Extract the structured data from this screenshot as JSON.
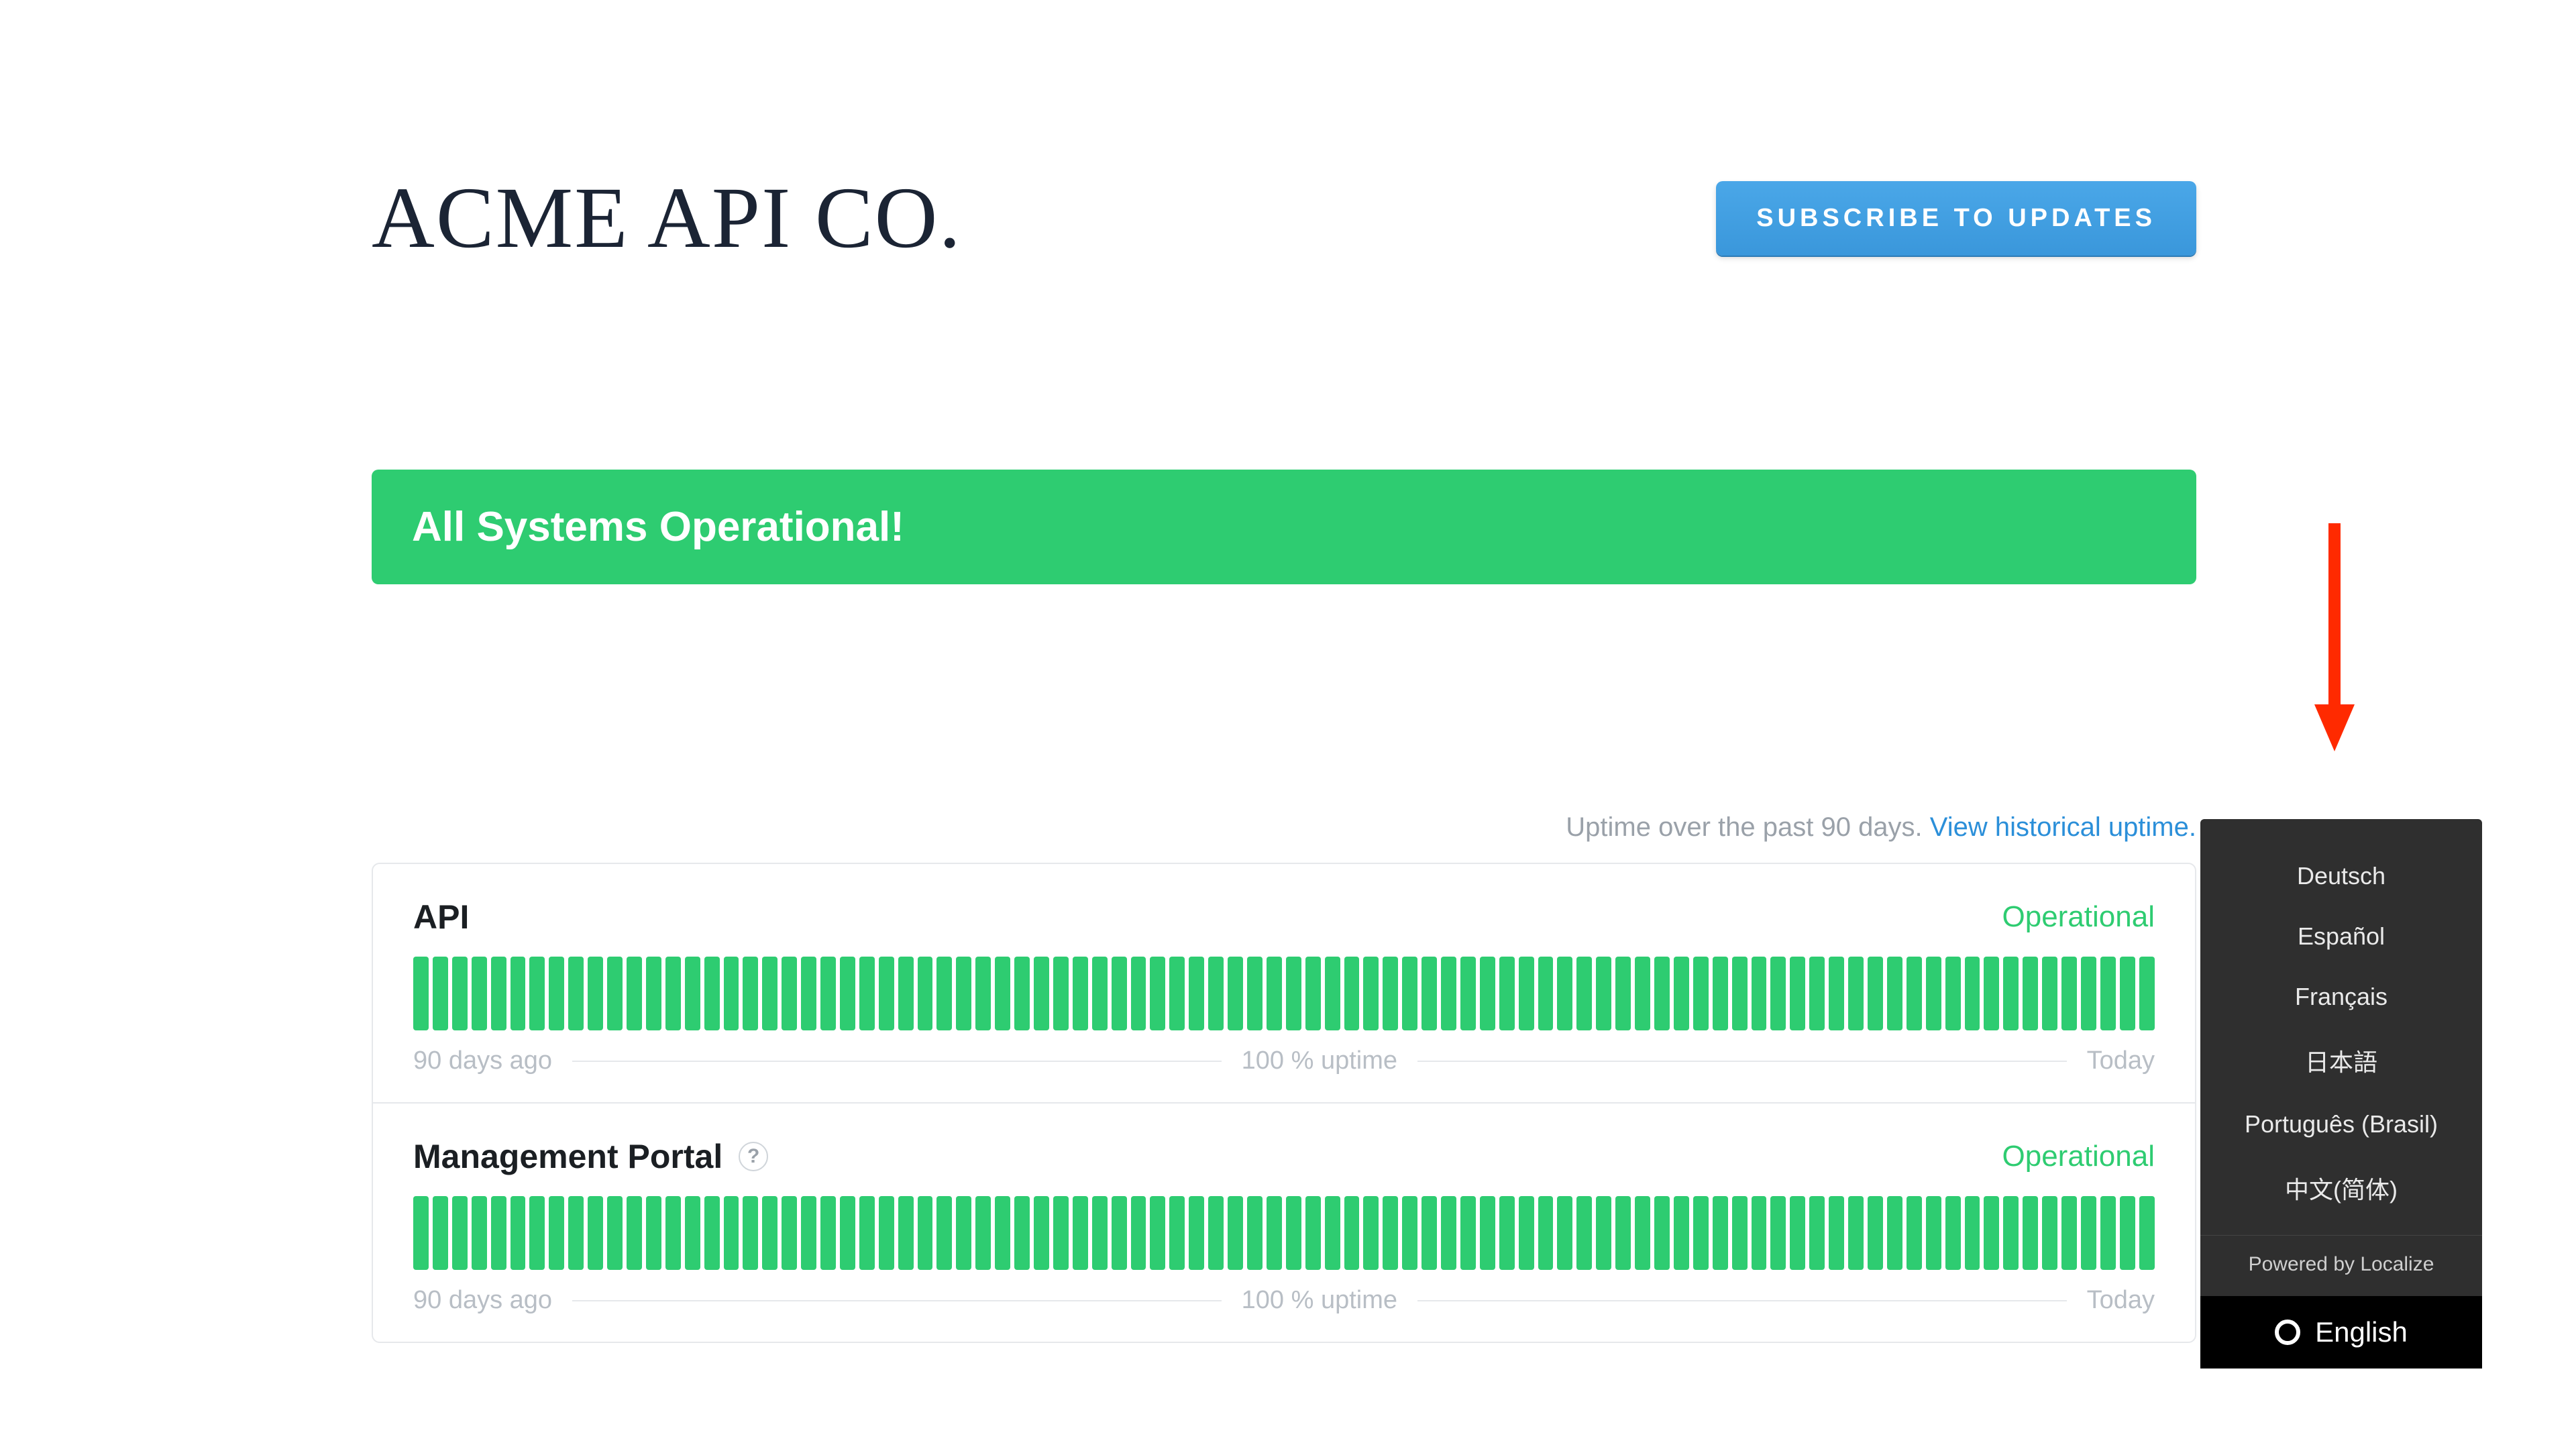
{
  "header": {
    "brand": "ACME API CO.",
    "subscribe_label": "SUBSCRIBE TO UPDATES"
  },
  "status_banner": "All Systems Operational!",
  "uptime_caption": {
    "text": "Uptime over the past 90 days. ",
    "link": "View historical uptime."
  },
  "components": [
    {
      "name": "API",
      "status": "Operational",
      "foot_left": "90 days ago",
      "foot_center": "100 % uptime",
      "foot_right": "Today",
      "help": false,
      "bars": 90,
      "bar_color": "#2ecc71"
    },
    {
      "name": "Management Portal",
      "status": "Operational",
      "foot_left": "90 days ago",
      "foot_center": "100 % uptime",
      "foot_right": "Today",
      "help": true,
      "help_icon": "?",
      "bars": 90,
      "bar_color": "#2ecc71"
    }
  ],
  "language_panel": {
    "options": [
      "Deutsch",
      "Español",
      "Français",
      "日本語",
      "Português (Brasil)",
      "中文(简体)"
    ],
    "powered_by": "Powered by Localize",
    "current": "English"
  },
  "annotation": {
    "color": "#ff2a00"
  }
}
